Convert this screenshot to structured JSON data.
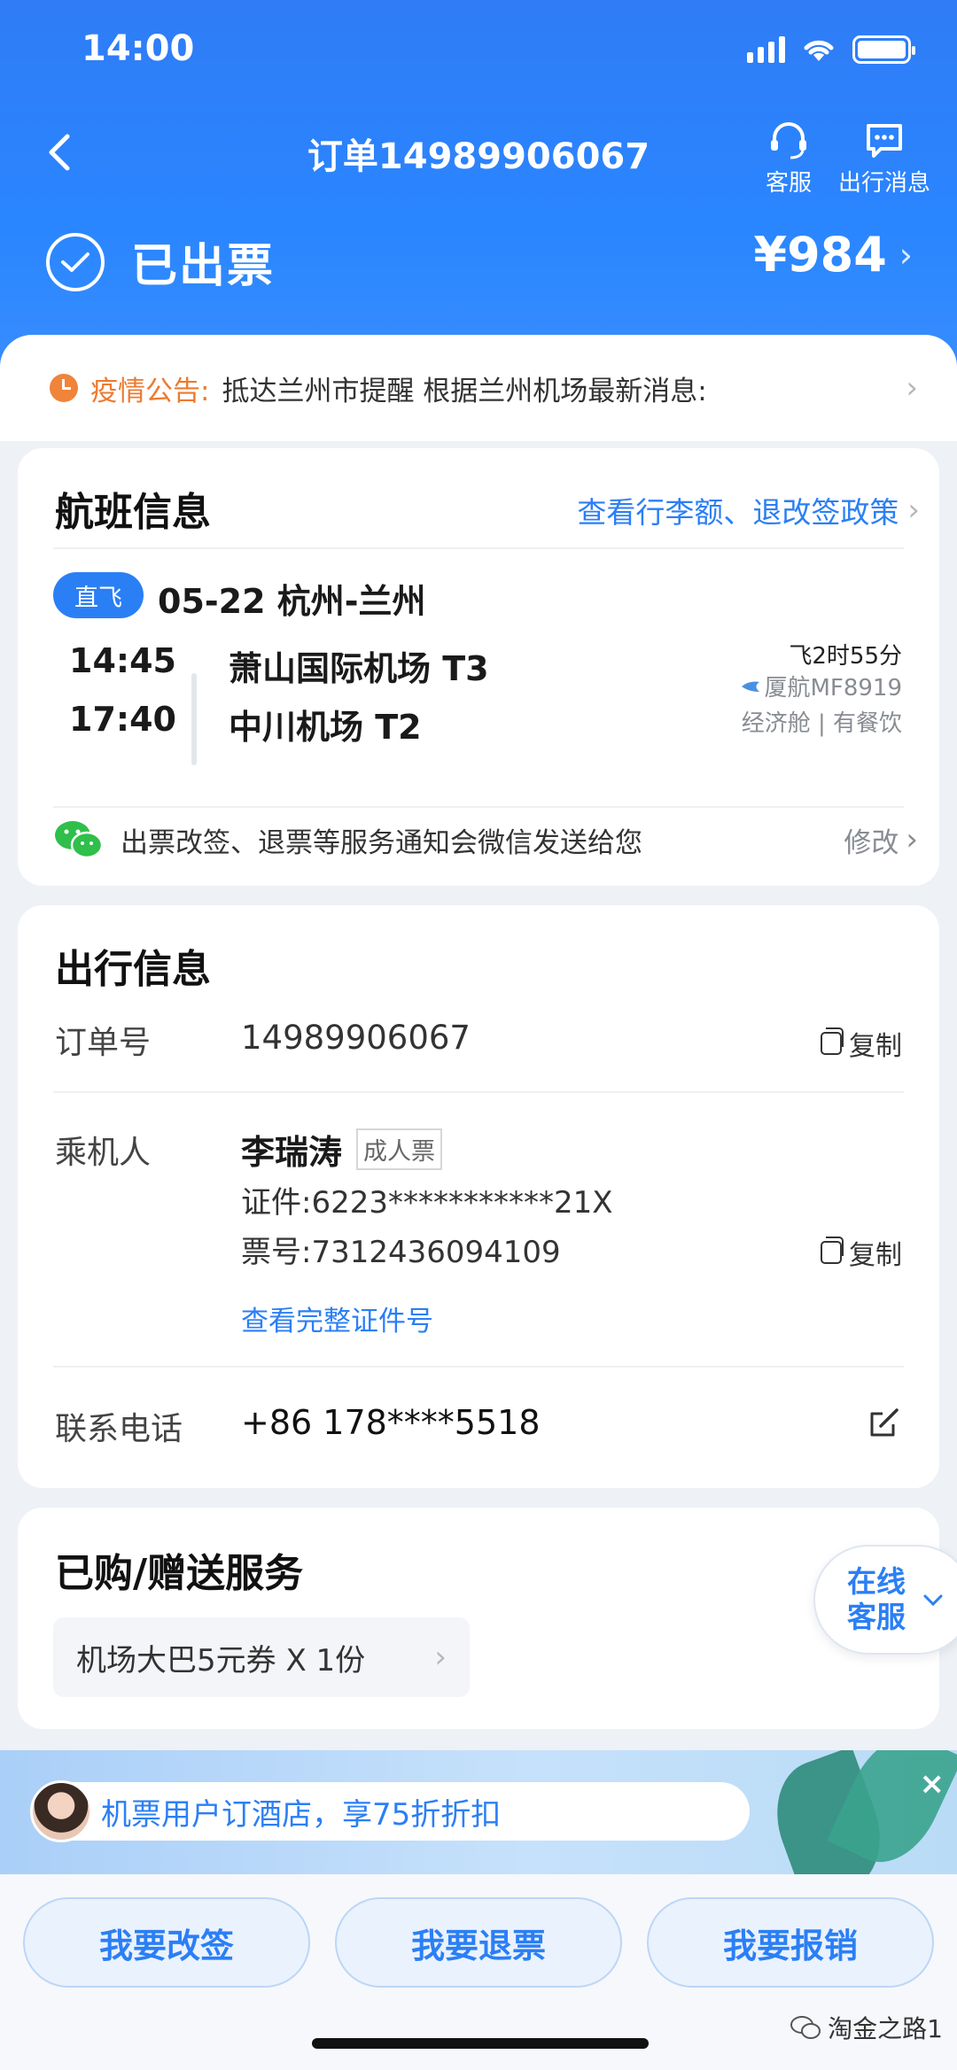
{
  "status_bar": {
    "time": "14:00"
  },
  "nav": {
    "title": "订单14989906067",
    "service_label": "客服",
    "messages_label": "出行消息"
  },
  "order_status": {
    "text": "已出票",
    "price": "¥984"
  },
  "notice": {
    "label": "疫情公告:",
    "text": "抵达兰州市提醒 根据兰州机场最新消息:"
  },
  "flight_card": {
    "title": "航班信息",
    "policy_link": "查看行李额、退改签政策",
    "badge": "直飞",
    "route": "05-22 杭州-兰州",
    "depart_time": "14:45",
    "depart_airport": "萧山国际机场 T3",
    "arrive_time": "17:40",
    "arrive_airport": "中川机场 T2",
    "duration": "飞2时55分",
    "airline": "厦航MF8919",
    "cabin": "经济舱 | 有餐饮",
    "wechat_notice": "出票改签、退票等服务通知会微信发送给您",
    "modify_label": "修改"
  },
  "trip_card": {
    "title": "出行信息",
    "order_no_label": "订单号",
    "order_no": "14989906067",
    "copy_label": "复制",
    "passenger_label": "乘机人",
    "passenger_name": "李瑞涛",
    "ticket_type": "成人票",
    "id_no": "证件:6223***********21X",
    "ticket_no": "票号:7312436094109",
    "view_full_id": "查看完整证件号",
    "phone_label": "联系电话",
    "phone": "+86 178****5518"
  },
  "services_card": {
    "title": "已购/赠送服务",
    "item": "机场大巴5元券 X 1份"
  },
  "online_service": {
    "label": "在线客服"
  },
  "hotel_banner": {
    "text": "机票用户订酒店，享75折折扣",
    "close": "×"
  },
  "actions": {
    "change": "我要改签",
    "refund": "我要退票",
    "reimburse": "我要报销"
  },
  "watermark": "淘金之路1"
}
